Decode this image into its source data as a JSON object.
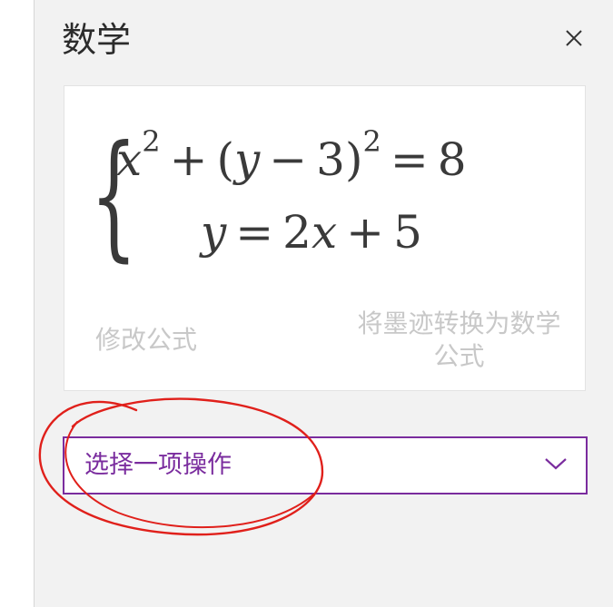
{
  "pane": {
    "title": "数学",
    "close_icon": "close-icon"
  },
  "equation": {
    "line1": {
      "x": "x",
      "sq1": "2",
      "plus": "+",
      "open": "(",
      "y": "y",
      "minus": "−",
      "three": "3",
      "close": ")",
      "sq2": "2",
      "eq": "=",
      "rhs": "8"
    },
    "line2": {
      "y": "y",
      "eq": "=",
      "two": "2",
      "x": "x",
      "plus": "+",
      "five": "5"
    }
  },
  "card_actions": {
    "edit_formula": "修改公式",
    "convert_ink": "将墨迹转换为数学公式"
  },
  "action_select": {
    "selected": "选择一项操作",
    "icon": "chevron-down-icon"
  },
  "colors": {
    "accent": "#7a2c9e",
    "annotation": "#e0201b",
    "disabled_text": "#c8c8c8"
  }
}
